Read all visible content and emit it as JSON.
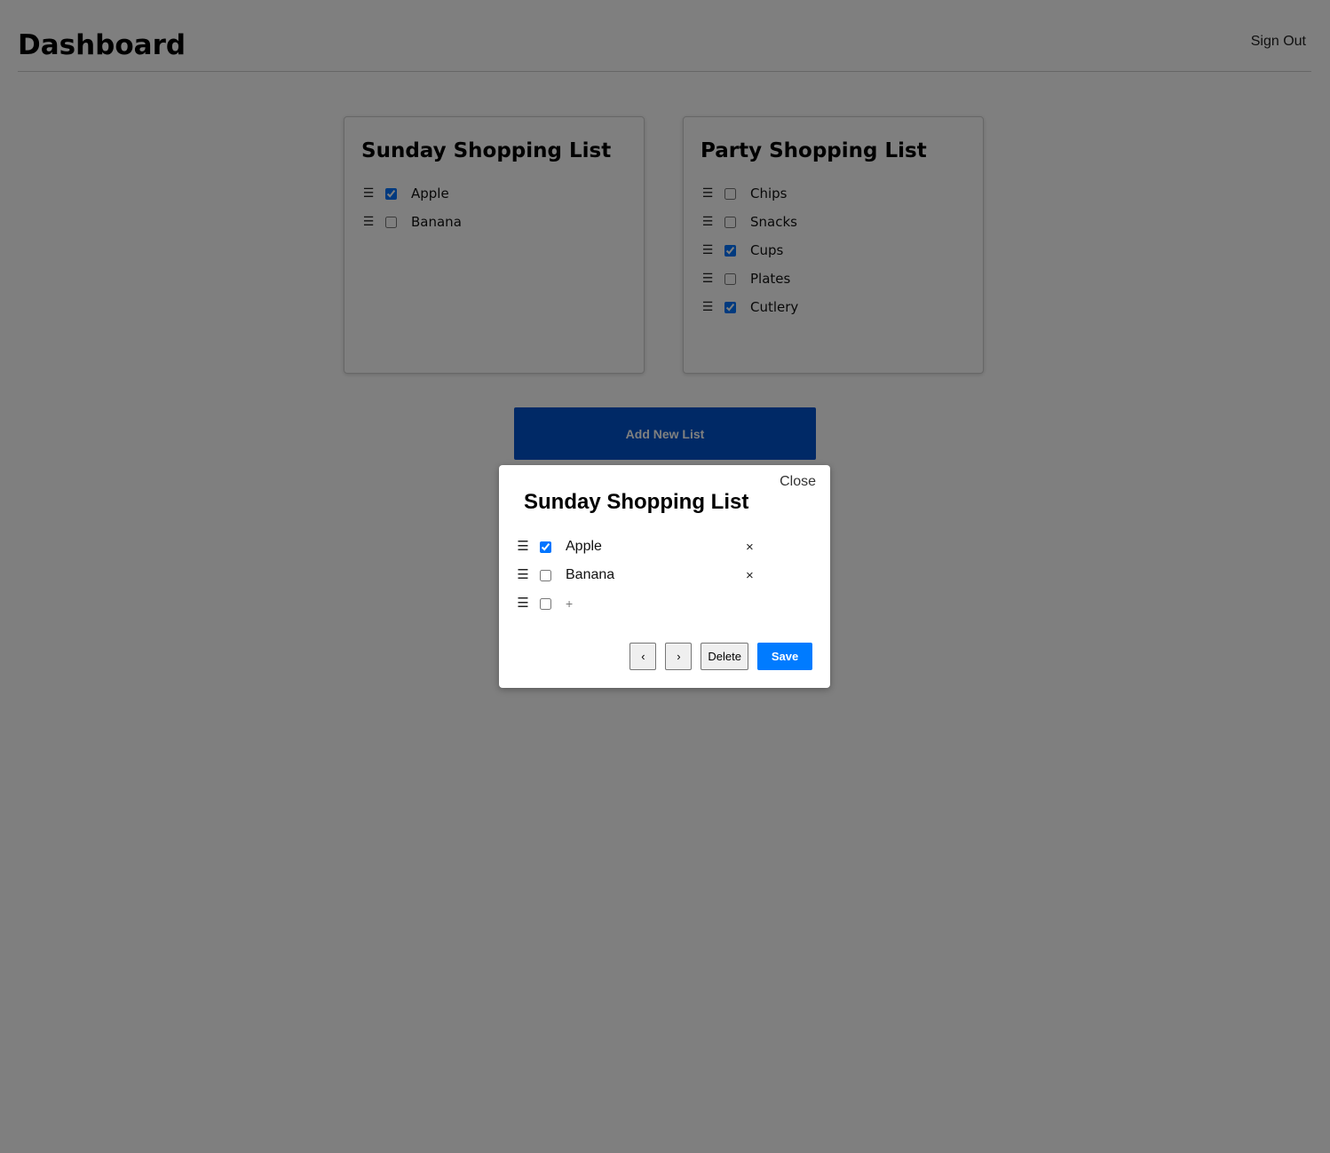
{
  "header": {
    "title": "Dashboard",
    "sign_out": "Sign Out"
  },
  "lists": [
    {
      "title": "Sunday Shopping List",
      "items": [
        {
          "label": "Apple",
          "checked": true
        },
        {
          "label": "Banana",
          "checked": false
        }
      ]
    },
    {
      "title": "Party Shopping List",
      "items": [
        {
          "label": "Chips",
          "checked": false
        },
        {
          "label": "Snacks",
          "checked": false
        },
        {
          "label": "Cups",
          "checked": true
        },
        {
          "label": "Plates",
          "checked": false
        },
        {
          "label": "Cutlery",
          "checked": true
        }
      ]
    }
  ],
  "add_list_button": "Add New List",
  "modal": {
    "close": "Close",
    "title": "Sunday Shopping List",
    "items": [
      {
        "label": "Apple",
        "checked": true
      },
      {
        "label": "Banana",
        "checked": false
      }
    ],
    "new_item_placeholder": "+",
    "prev": "‹",
    "next": "›",
    "delete": "Delete",
    "save": "Save"
  },
  "icons": {
    "drag_handle": "☰",
    "remove": "×"
  },
  "colors": {
    "primary": "#007bff",
    "add_button": "#0052cc",
    "overlay": "rgba(0,0,0,0.5)"
  }
}
